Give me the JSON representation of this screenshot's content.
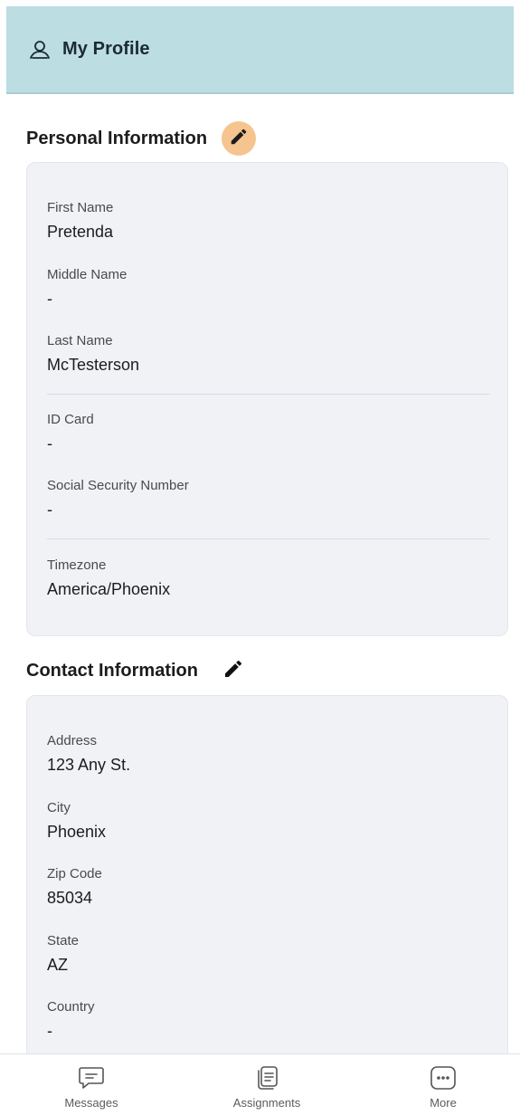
{
  "header": {
    "title": "My Profile",
    "icon": "user-icon"
  },
  "personal": {
    "title": "Personal Information",
    "edit_icon": "pencil-icon",
    "fields": {
      "first_name": {
        "label": "First Name",
        "value": "Pretenda"
      },
      "middle_name": {
        "label": "Middle Name",
        "value": "-"
      },
      "last_name": {
        "label": "Last Name",
        "value": "McTesterson"
      },
      "id_card": {
        "label": "ID Card",
        "value": "-"
      },
      "ssn": {
        "label": "Social Security Number",
        "value": "-"
      },
      "timezone": {
        "label": "Timezone",
        "value": "America/Phoenix"
      }
    }
  },
  "contact": {
    "title": "Contact Information",
    "edit_icon": "pencil-icon",
    "fields": {
      "address": {
        "label": "Address",
        "value": "123 Any St."
      },
      "city": {
        "label": "City",
        "value": "Phoenix"
      },
      "zip": {
        "label": "Zip Code",
        "value": "85034"
      },
      "state": {
        "label": "State",
        "value": "AZ"
      },
      "country": {
        "label": "Country",
        "value": "-"
      }
    }
  },
  "nav": {
    "messages": {
      "label": "Messages",
      "icon": "message-icon"
    },
    "assignments": {
      "label": "Assignments",
      "icon": "document-list-icon"
    },
    "more": {
      "label": "More",
      "icon": "more-icon"
    }
  },
  "colors": {
    "header_bg": "#bcdde2",
    "card_bg": "#f0f2f6",
    "accent_edit": "#f6c48e"
  }
}
